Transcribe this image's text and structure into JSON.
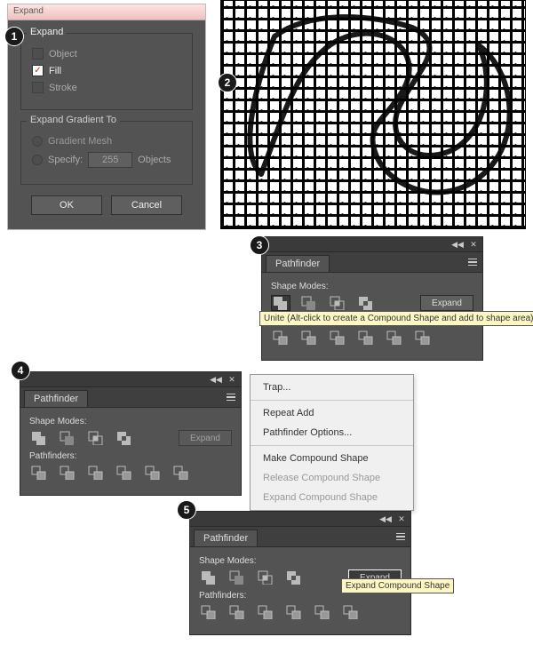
{
  "expand_dialog": {
    "title": "Expand",
    "group_expand": {
      "title": "Expand",
      "object": "Object",
      "fill": "Fill",
      "stroke": "Stroke"
    },
    "group_gradient": {
      "title": "Expand Gradient To",
      "mesh": "Gradient Mesh",
      "specify_label": "Specify:",
      "specify_value": "255",
      "specify_suffix": "Objects"
    },
    "ok": "OK",
    "cancel": "Cancel"
  },
  "pathfinder": {
    "tab": "Pathfinder",
    "shape_modes": "Shape Modes:",
    "pathfinders": "Pathfinders:",
    "expand": "Expand"
  },
  "tooltip_unite": "Unite (Alt-click to create a Compound Shape and add to shape area)",
  "tooltip_expand_compound": "Expand Compound Shape",
  "context_menu": {
    "trap": "Trap...",
    "repeat_add": "Repeat Add",
    "options": "Pathfinder Options...",
    "make": "Make Compound Shape",
    "release": "Release Compound Shape",
    "expand": "Expand Compound Shape"
  }
}
